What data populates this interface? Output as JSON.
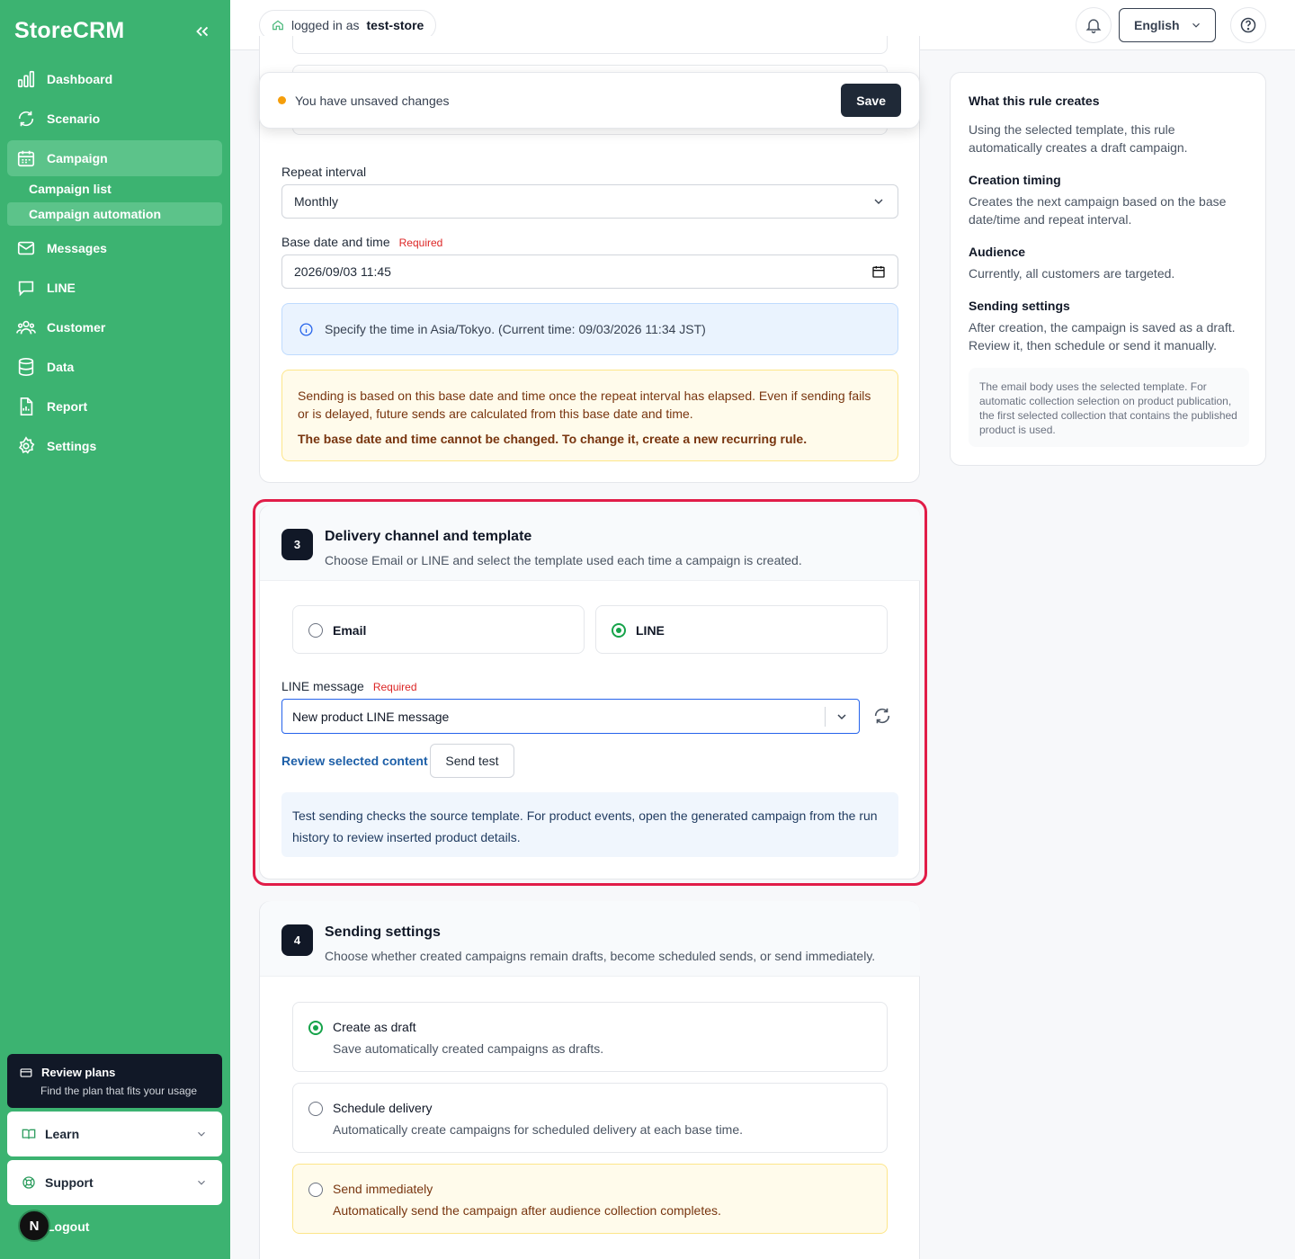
{
  "sidebar": {
    "brand": "StoreCRM",
    "nav": [
      {
        "label": "Dashboard",
        "icon": "bar-chart-icon"
      },
      {
        "label": "Scenario",
        "icon": "cycle-icon"
      },
      {
        "label": "Campaign",
        "icon": "calendar-icon",
        "active": true
      },
      {
        "label": "Messages",
        "icon": "mail-icon"
      },
      {
        "label": "LINE",
        "icon": "chat-icon"
      },
      {
        "label": "Customer",
        "icon": "users-icon"
      },
      {
        "label": "Data",
        "icon": "database-icon"
      },
      {
        "label": "Report",
        "icon": "report-icon"
      },
      {
        "label": "Settings",
        "icon": "gear-icon"
      }
    ],
    "campaign_sub": [
      "Campaign list",
      "Campaign automation"
    ],
    "plan": {
      "title": "Review plans",
      "subtitle": "Find the plan that fits your usage"
    },
    "learn": "Learn",
    "support": "Support",
    "logout": "Logout",
    "avatar_letter": "N"
  },
  "topbar": {
    "login_prefix": "logged in as",
    "store": "test-store",
    "language": "English"
  },
  "unsaved": {
    "message": "You have unsaved changes",
    "save": "Save"
  },
  "schedule": {
    "repeat_label": "Repeat interval",
    "repeat_value": "Monthly",
    "base_label": "Base date and time",
    "required": "Required",
    "base_value": "2026/09/03 11:45",
    "timezone_info": "Specify the time in Asia/Tokyo. (Current time: 09/03/2026 11:34 JST)",
    "warning_1": "Sending is based on this base date and time once the repeat interval has elapsed. Even if sending fails or is delayed, future sends are calculated from this base date and time.",
    "warning_2": "The base date and time cannot be changed. To change it, create a new recurring rule."
  },
  "delivery": {
    "step": "3",
    "title": "Delivery channel and template",
    "subtitle": "Choose Email or LINE and select the template used each time a campaign is created.",
    "channels": [
      {
        "label": "Email",
        "selected": false
      },
      {
        "label": "LINE",
        "selected": true
      }
    ],
    "line_label": "LINE message",
    "required": "Required",
    "line_value": "New product LINE message",
    "review_link": "Review selected content",
    "send_test": "Send test",
    "note": "Test sending checks the source template. For product events, open the generated campaign from the run history to review inserted product details."
  },
  "sending": {
    "step": "4",
    "title": "Sending settings",
    "subtitle": "Choose whether created campaigns remain drafts, become scheduled sends, or send immediately.",
    "options": [
      {
        "label": "Create as draft",
        "desc": "Save automatically created campaigns as drafts.",
        "selected": true
      },
      {
        "label": "Schedule delivery",
        "desc": "Automatically create campaigns for scheduled delivery at each base time.",
        "selected": false
      },
      {
        "label": "Send immediately",
        "desc": "Automatically send the campaign after audience collection completes.",
        "selected": false
      }
    ]
  },
  "right_panel": {
    "title": "What this rule creates",
    "intro": "Using the selected template, this rule automatically creates a draft campaign.",
    "timing_title": "Creation timing",
    "timing_text": "Creates the next campaign based on the base date/time and repeat interval.",
    "audience_title": "Audience",
    "audience_text": "Currently, all customers are targeted.",
    "sending_title": "Sending settings",
    "sending_text": "After creation, the campaign is saved as a draft. Review it, then schedule or send it manually.",
    "note": "The email body uses the selected template. For automatic collection selection on product publication, the first selected collection that contains the published product is used."
  },
  "colors": {
    "sidebar": "#3cb371",
    "highlight": "#e11d48",
    "selected": "#16a34a",
    "dark": "#111827"
  }
}
